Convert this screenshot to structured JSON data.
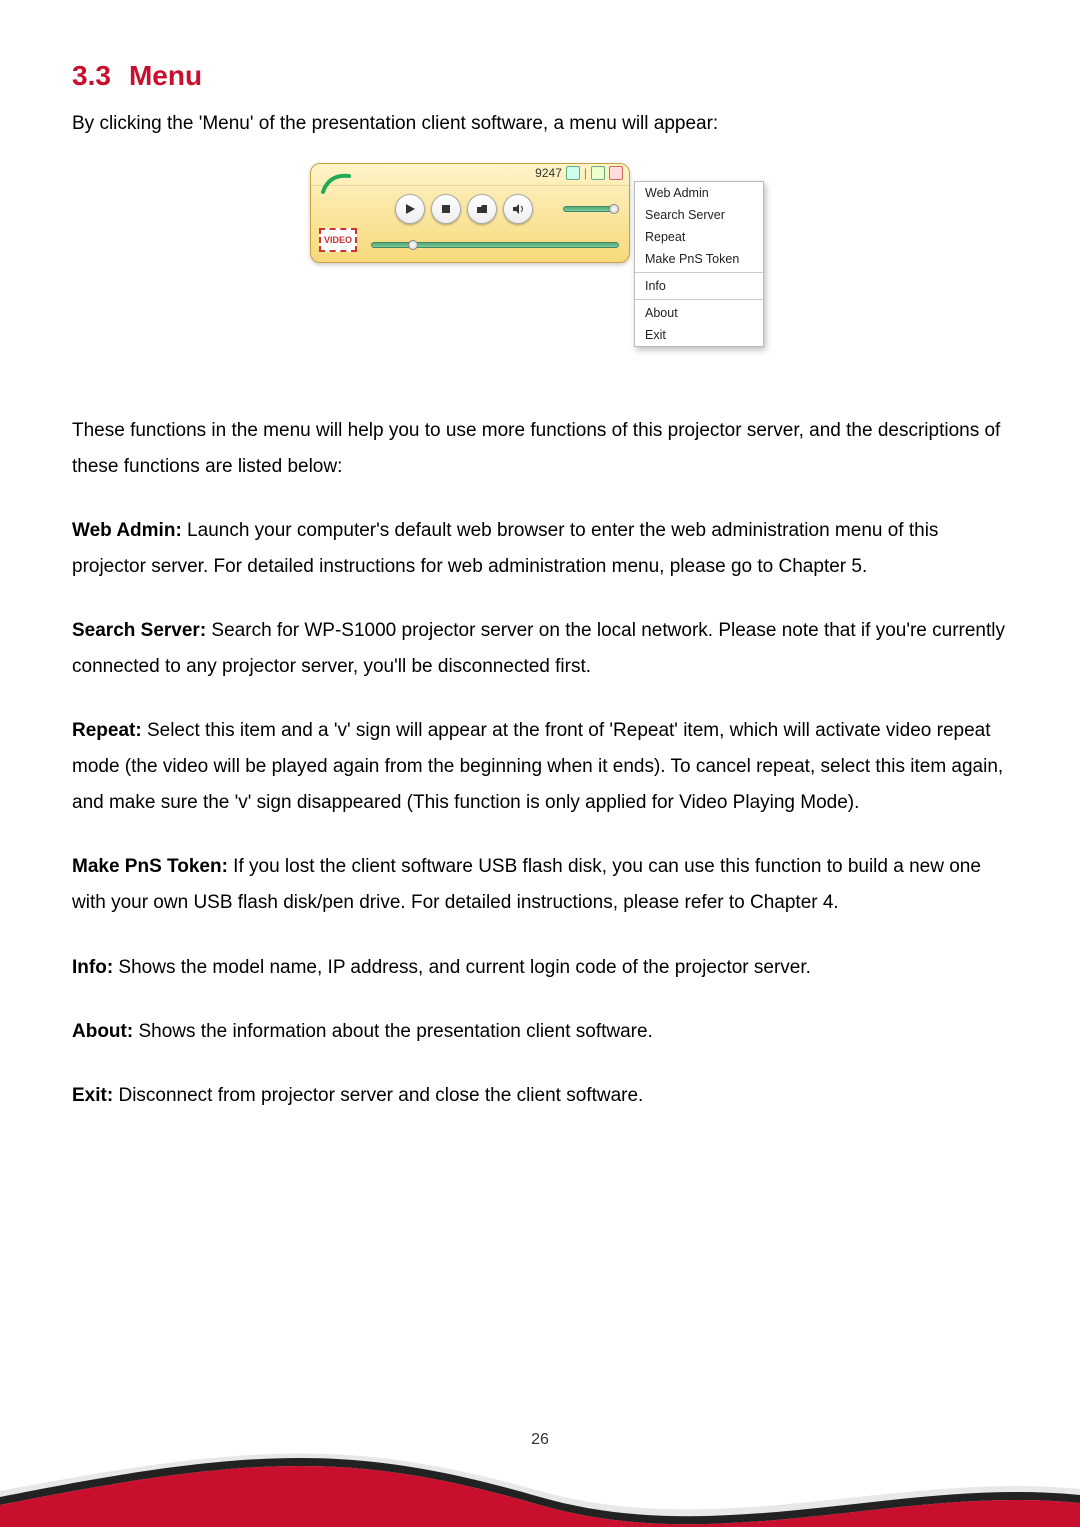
{
  "heading": {
    "number": "3.3",
    "title": "Menu"
  },
  "intro": "By clicking the 'Menu' of the presentation client software, a menu will appear:",
  "player": {
    "code": "9247",
    "video_badge": "VIDEO"
  },
  "menu": {
    "items_a": [
      "Web Admin",
      "Search Server",
      "Repeat",
      "Make PnS Token"
    ],
    "items_b": [
      "Info"
    ],
    "items_c": [
      "About",
      "Exit"
    ]
  },
  "para_intro2": "These functions in the menu will help you to use more functions of this projector server, and the descriptions of these functions are listed below:",
  "desc": {
    "web_admin_label": "Web Admin:",
    "web_admin_text": " Launch your computer's default web browser to enter the web administration menu of this projector server. For detailed instructions for web administration menu, please go to Chapter 5.",
    "search_label": "Search Server:",
    "search_text": " Search for WP-S1000 projector server on the local network. Please note that if you're currently connected to any projector server, you'll be disconnected first.",
    "repeat_label": "Repeat:",
    "repeat_text": " Select this item and a 'v' sign will appear at the front of 'Repeat' item, which will activate video repeat mode (the video will be played again from the beginning when it ends). To cancel repeat, select this item again, and make sure the 'v' sign disappeared (This function is only applied for Video Playing Mode).",
    "token_label": "Make PnS Token:",
    "token_text": " If you lost the client software USB flash disk, you can use this function to build a new one with your own USB flash disk/pen drive. For detailed instructions, please refer to Chapter 4.",
    "info_label": "Info:",
    "info_text": " Shows the model name, IP address, and current login code of the projector server.",
    "about_label": "About:",
    "about_text": " Shows the information about the presentation client software.",
    "exit_label": "Exit:",
    "exit_text": " Disconnect from projector server and close the client software."
  },
  "page_number": "26"
}
